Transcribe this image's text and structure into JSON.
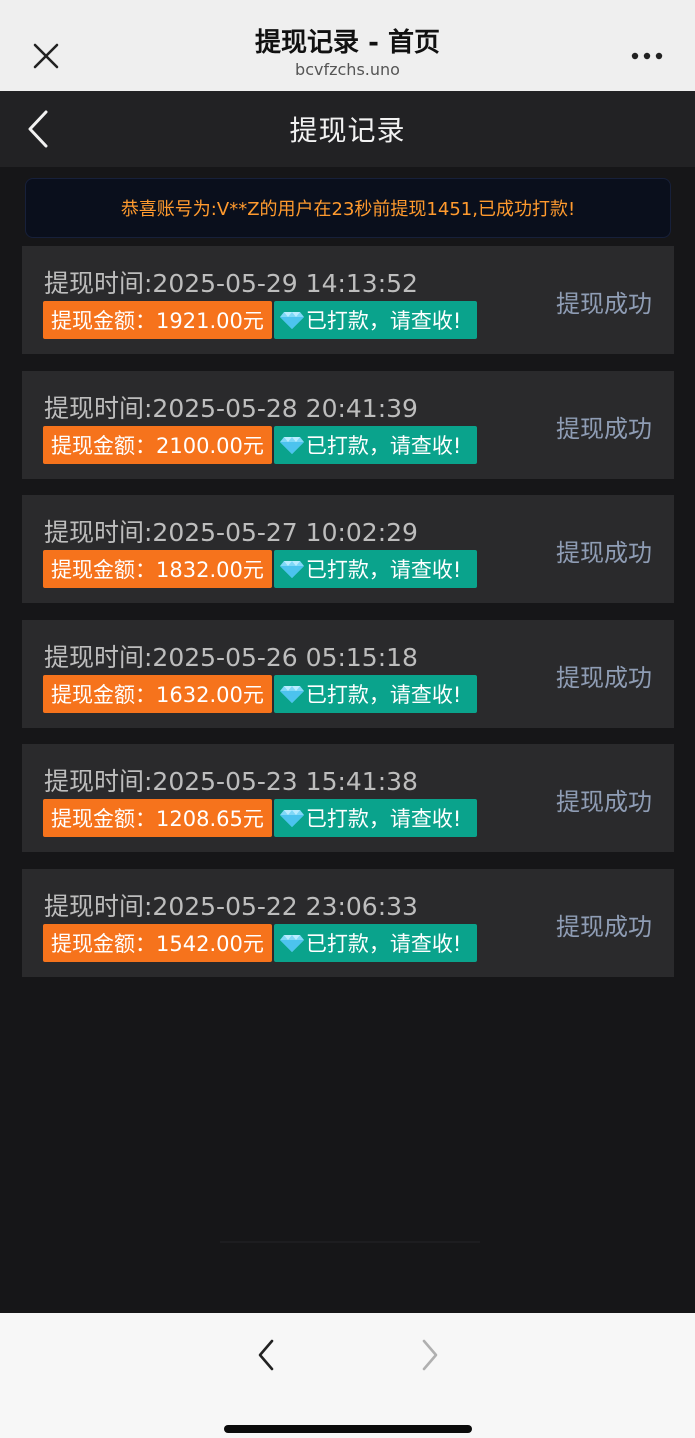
{
  "browser": {
    "title": "提现记录 - 首页",
    "url": "bcvfzchs.uno",
    "close_icon": "close-icon",
    "more_icon": "more-icon"
  },
  "header": {
    "title": "提现记录",
    "back_icon": "chevron-left-icon"
  },
  "notice": {
    "text": "恭喜账号为:V**Z的用户在23秒前提现1451,已成功打款!"
  },
  "records": [
    {
      "time": "提现时间:2025-05-29 14:13:52",
      "amount": "提现金额：1921.00元",
      "paid": "已打款，请查收!",
      "status": "提现成功"
    },
    {
      "time": "提现时间:2025-05-28 20:41:39",
      "amount": "提现金额：2100.00元",
      "paid": "已打款，请查收!",
      "status": "提现成功"
    },
    {
      "time": "提现时间:2025-05-27 10:02:29",
      "amount": "提现金额：1832.00元",
      "paid": "已打款，请查收!",
      "status": "提现成功"
    },
    {
      "time": "提现时间:2025-05-26 05:15:18",
      "amount": "提现金额：1632.00元",
      "paid": "已打款，请查收!",
      "status": "提现成功"
    },
    {
      "time": "提现时间:2025-05-23 15:41:38",
      "amount": "提现金额：1208.65元",
      "paid": "已打款，请查收!",
      "status": "提现成功"
    },
    {
      "time": "提现时间:2025-05-22 23:06:33",
      "amount": "提现金额：1542.00元",
      "paid": "已打款，请查收!",
      "status": "提现成功"
    }
  ],
  "colors": {
    "accent_orange": "#f6731c",
    "paid_teal": "#0aa38c",
    "notice_text": "#ff9a2e",
    "status_text": "#8f9db5"
  },
  "bottom_nav": {
    "back_icon": "chevron-left-icon",
    "forward_icon": "chevron-right-icon"
  }
}
